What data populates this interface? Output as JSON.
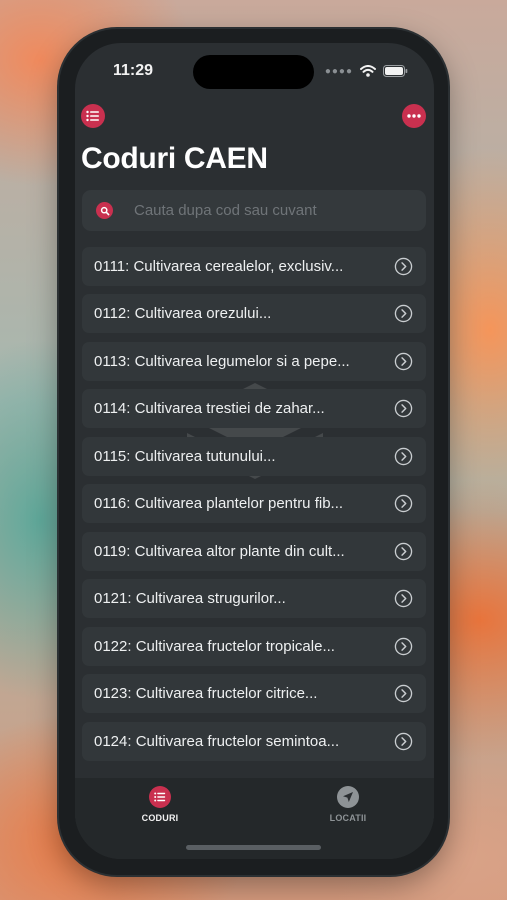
{
  "status_bar": {
    "time": "11:29",
    "signal_icon": "signal-dots-icon",
    "wifi_icon": "wifi-icon",
    "battery_icon": "battery-icon"
  },
  "header": {
    "left_icon": "list-icon",
    "right_icon": "more-icon",
    "title": "Coduri CAEN"
  },
  "search": {
    "icon": "search-icon",
    "placeholder": "Cauta dupa cod sau cuvant"
  },
  "list": {
    "items": [
      {
        "label": "0111: Cultivarea cerealelor, exclusiv..."
      },
      {
        "label": "0112: Cultivarea orezului..."
      },
      {
        "label": "0113: Cultivarea legumelor si a pepe..."
      },
      {
        "label": "0114: Cultivarea trestiei de zahar..."
      },
      {
        "label": "0115: Cultivarea tutunului..."
      },
      {
        "label": "0116: Cultivarea plantelor pentru fib..."
      },
      {
        "label": "0119: Cultivarea altor plante din cult..."
      },
      {
        "label": "0121: Cultivarea strugurilor..."
      },
      {
        "label": "0122: Cultivarea fructelor tropicale..."
      },
      {
        "label": "0123: Cultivarea fructelor citrice..."
      },
      {
        "label": "0124: Cultivarea fructelor semintoa..."
      }
    ],
    "chevron_icon": "chevron-right-circle-icon"
  },
  "tabbar": {
    "tabs": [
      {
        "label": "CODURI",
        "icon": "list-icon",
        "active": true
      },
      {
        "label": "LOCATII",
        "icon": "location-arrow-icon",
        "active": false
      }
    ]
  },
  "colors": {
    "accent": "#c9304f",
    "background": "#2b2f32",
    "row": "#32373a",
    "text": "#eef0f1"
  }
}
